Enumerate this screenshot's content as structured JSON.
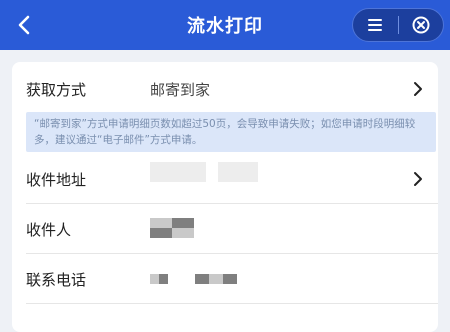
{
  "header": {
    "title": "流水打印",
    "back_icon": "back-arrow-icon",
    "menu_icon": "menu-lines-icon",
    "close_icon": "close-circle-icon",
    "bg_color": "#2a5bd7"
  },
  "form": {
    "method_label": "获取方式",
    "method_value": "邮寄到家",
    "notice": "“邮寄到家”方式申请明细页数如超过50页，会导致申请失败；如您申请时段明细较多，建议通过“电子邮件”方式申请。",
    "address_label": "收件地址",
    "recipient_label": "收件人",
    "phone_label": "联系电话"
  }
}
